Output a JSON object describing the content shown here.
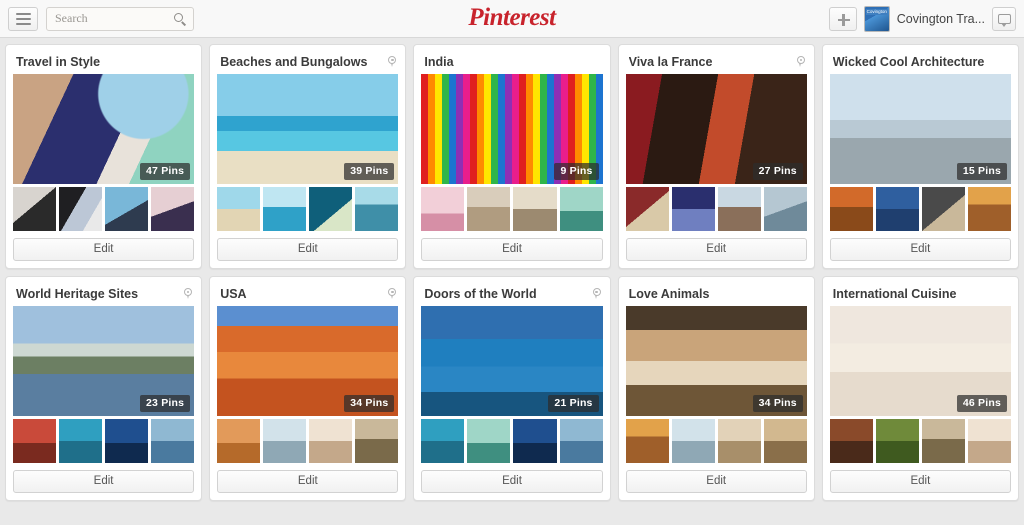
{
  "header": {
    "menu_icon": "hamburger-menu-icon",
    "search": {
      "placeholder": "Search",
      "value": "",
      "icon": "search-icon"
    },
    "brand": "Pinterest",
    "add_icon": "plus-icon",
    "username": "Covington Tra...",
    "avatar_label": "Covington",
    "notifications_icon": "message-bubble-icon"
  },
  "boards": [
    {
      "title": "Travel in Style",
      "pins": "47 Pins",
      "is_place": false,
      "edit_label": "Edit",
      "cover_art": "a-travel",
      "thumbs": [
        "t1",
        "t2",
        "t3",
        "t4"
      ]
    },
    {
      "title": "Beaches and Bungalows",
      "pins": "39 Pins",
      "is_place": true,
      "edit_label": "Edit",
      "cover_art": "a-beach",
      "thumbs": [
        "t5",
        "t6",
        "t7",
        "t8"
      ]
    },
    {
      "title": "India",
      "pins": "9 Pins",
      "is_place": false,
      "edit_label": "Edit",
      "cover_art": "a-india",
      "thumbs": [
        "t9",
        "t10",
        "t11",
        "t12"
      ]
    },
    {
      "title": "Viva la France",
      "pins": "27 Pins",
      "is_place": true,
      "edit_label": "Edit",
      "cover_art": "a-france",
      "thumbs": [
        "t13",
        "t14",
        "t15",
        "t16"
      ]
    },
    {
      "title": "Wicked Cool Architecture",
      "pins": "15 Pins",
      "is_place": false,
      "edit_label": "Edit",
      "cover_art": "a-arch",
      "thumbs": [
        "t17",
        "t18",
        "t19",
        "t20"
      ]
    },
    {
      "title": "World Heritage Sites",
      "pins": "23 Pins",
      "is_place": true,
      "edit_label": "Edit",
      "cover_art": "a-heritage",
      "thumbs": [
        "t21",
        "t22",
        "t23",
        "t24"
      ]
    },
    {
      "title": "USA",
      "pins": "34 Pins",
      "is_place": true,
      "edit_label": "Edit",
      "cover_art": "a-usa",
      "thumbs": [
        "t25",
        "t26",
        "t27",
        "t28"
      ]
    },
    {
      "title": "Doors of the World",
      "pins": "21 Pins",
      "is_place": true,
      "edit_label": "Edit",
      "cover_art": "a-doors",
      "thumbs": [
        "t22",
        "t12",
        "t23",
        "t24"
      ]
    },
    {
      "title": "Love Animals",
      "pins": "34 Pins",
      "is_place": false,
      "edit_label": "Edit",
      "cover_art": "a-animals",
      "thumbs": [
        "t20",
        "t26",
        "t31",
        "t32"
      ]
    },
    {
      "title": "International Cuisine",
      "pins": "46 Pins",
      "is_place": false,
      "edit_label": "Edit",
      "cover_art": "a-cuisine",
      "thumbs": [
        "t29",
        "t30",
        "t28",
        "t27"
      ]
    }
  ],
  "colors": {
    "brand_red": "#c8232c",
    "page_bg": "#e9e9e9",
    "card_bg": "#ffffff",
    "badge_bg": "rgba(45,45,45,0.72)"
  }
}
